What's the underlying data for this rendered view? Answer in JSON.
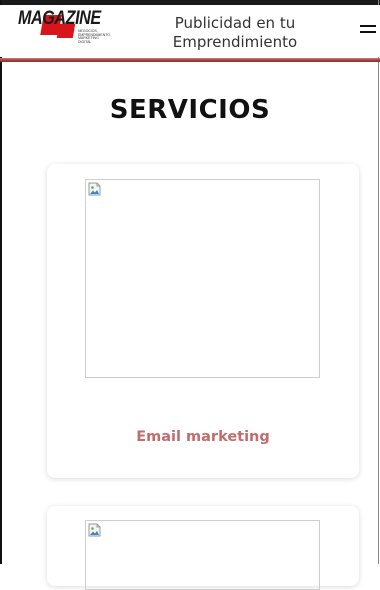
{
  "header": {
    "logo": {
      "wordmark": "MAGAZINE",
      "tagline": "NEGOCIOS, EMPRENDIMIENTO, MARKETING DIGITAL"
    },
    "title_line1": "Publicidad en tu",
    "title_line2": "Emprendimiento",
    "menu_icon": "hamburger-icon"
  },
  "main": {
    "section_title": "SERVICIOS",
    "cards": [
      {
        "label": "Email marketing",
        "image": "broken-image-icon"
      },
      {
        "label": "",
        "image": "broken-image-icon"
      }
    ]
  },
  "colors": {
    "accent": "#c46b6b",
    "header_line": "#a94545",
    "logo_red": "#d7151b"
  }
}
